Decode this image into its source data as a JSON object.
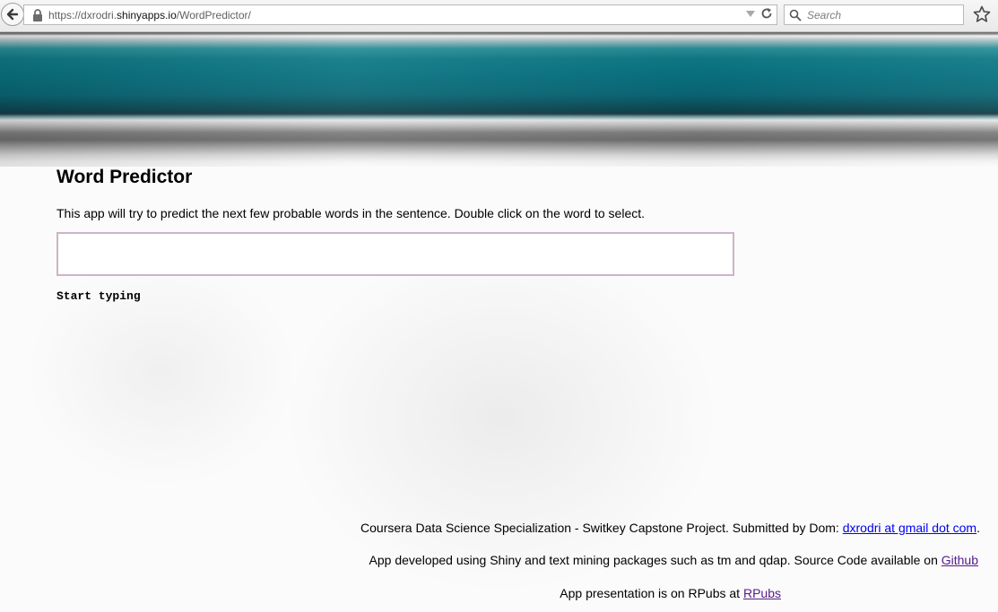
{
  "browser": {
    "url_prefix": "https://dxrodri.",
    "url_domain": "shinyapps.io",
    "url_path": "/WordPredictor/",
    "search_placeholder": "Search"
  },
  "page": {
    "title": "Word Predictor",
    "description": "This app will try to predict the next few probable words in the sentence. Double click on the word to select.",
    "input_value": "",
    "prediction_text": "Start typing"
  },
  "footer": {
    "line1_text": "Coursera Data Science Specialization - Switkey Capstone Project. Submitted by Dom: ",
    "line1_link": "dxrodri at gmail dot com",
    "line1_suffix": ".",
    "line2_text": "App developed using Shiny and text mining packages such as tm and qdap. Source Code available on ",
    "line2_link": "Github",
    "line3_text": "App presentation is on RPubs at ",
    "line3_link": "RPubs"
  },
  "colors": {
    "banner_teal": "#0a6f7d",
    "input_border": "#cdb4c6",
    "link": "#0000ee",
    "visited_link": "#551a8b"
  },
  "icons": [
    "back-arrow-icon",
    "lock-icon",
    "dropdown-arrow-icon",
    "reload-icon",
    "search-icon",
    "bookmark-star-icon"
  ]
}
